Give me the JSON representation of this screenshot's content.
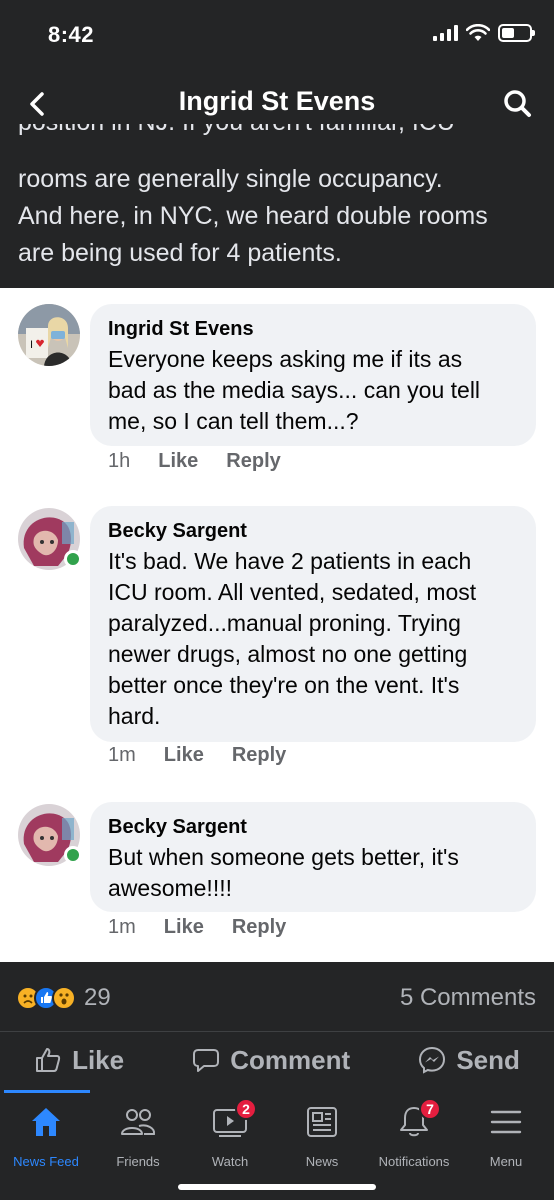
{
  "status_bar": {
    "time": "8:42"
  },
  "nav": {
    "title": "Ingrid St Evens"
  },
  "post": {
    "cut_line": "position in NJ. If you aren't familiar, ICU",
    "lines": [
      "rooms are generally single occupancy.",
      "And here, in NYC, we heard double rooms",
      "are being used for 4 patients."
    ]
  },
  "comments": [
    {
      "author": "Ingrid St Evens",
      "lines": [
        "Everyone keeps asking me if its as",
        "bad as the media says... can you tell",
        "me, so I can tell them...?"
      ],
      "time": "1h",
      "like": "Like",
      "reply": "Reply"
    },
    {
      "author": "Becky Sargent",
      "lines": [
        "It's bad. We have 2 patients in each",
        "ICU room. All vented, sedated, most",
        "paralyzed...manual proning. Trying",
        "newer drugs, almost no one getting",
        "better once they're on the vent. It's",
        "hard."
      ],
      "time": "1m",
      "like": "Like",
      "reply": "Reply"
    },
    {
      "author": "Becky Sargent",
      "lines": [
        "But when someone gets better, it's",
        "awesome!!!!"
      ],
      "time": "1m",
      "like": "Like",
      "reply": "Reply"
    }
  ],
  "reactions": {
    "count": "29",
    "icons": [
      "sad-icon",
      "like-icon",
      "wow-icon"
    ]
  },
  "comments_count": "5 Comments",
  "actions": {
    "like": "Like",
    "comment": "Comment",
    "send": "Send"
  },
  "tabbar": {
    "tabs": [
      {
        "label": "News Feed",
        "icon": "home-icon",
        "active": true
      },
      {
        "label": "Friends",
        "icon": "friends-icon"
      },
      {
        "label": "Watch",
        "icon": "watch-icon",
        "badge": "2"
      },
      {
        "label": "News",
        "icon": "news-icon"
      },
      {
        "label": "Notifications",
        "icon": "bell-icon",
        "badge": "7"
      },
      {
        "label": "Menu",
        "icon": "menu-icon"
      }
    ]
  },
  "colors": {
    "accent": "#2d88ff",
    "dark_bg": "#242526",
    "badge": "#e41e3f",
    "online": "#31a24c"
  }
}
